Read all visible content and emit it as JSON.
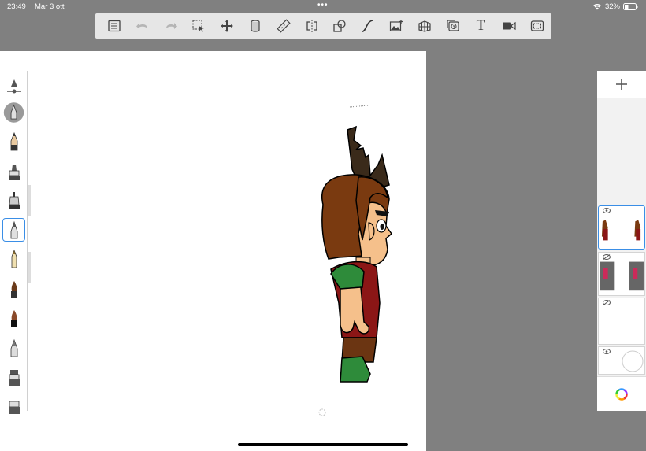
{
  "status": {
    "time": "23:49",
    "date": "Mar 3 ott",
    "battery": "32%"
  },
  "toolbar": {
    "tools": [
      {
        "name": "gallery-list-icon"
      },
      {
        "name": "undo-icon"
      },
      {
        "name": "redo-icon"
      },
      {
        "name": "selection-icon"
      },
      {
        "name": "transform-icon"
      },
      {
        "name": "fill-icon"
      },
      {
        "name": "ruler-icon"
      },
      {
        "name": "symmetry-icon"
      },
      {
        "name": "shapes-icon"
      },
      {
        "name": "curve-icon"
      },
      {
        "name": "import-image-icon"
      },
      {
        "name": "perspective-icon"
      },
      {
        "name": "timelapse-icon"
      },
      {
        "name": "text-icon",
        "label": "T"
      },
      {
        "name": "video-icon"
      },
      {
        "name": "fullscreen-icon"
      }
    ]
  },
  "brushes": [
    {
      "name": "brush-size-slider"
    },
    {
      "name": "brush-opacity"
    },
    {
      "name": "pencil-brush"
    },
    {
      "name": "marker-brush"
    },
    {
      "name": "airbrush-brush"
    },
    {
      "name": "hard-brush"
    },
    {
      "name": "ink-pen-brush"
    },
    {
      "name": "paint-brush"
    },
    {
      "name": "dark-brush"
    },
    {
      "name": "smudge-brush"
    },
    {
      "name": "eraser-brush"
    },
    {
      "name": "bucket-brush"
    }
  ],
  "layers": [
    {
      "name": "layer-1",
      "visible": true,
      "selected": true
    },
    {
      "name": "layer-2",
      "visible": false,
      "selected": false
    },
    {
      "name": "layer-3",
      "visible": false,
      "selected": false
    },
    {
      "name": "layer-background",
      "visible": true,
      "selected": false
    }
  ],
  "colors": {
    "accent": "#3a8ee6",
    "canvas_bg": "#808080",
    "hair": "#7a3a10",
    "skin": "#f5c08b",
    "vest": "#8b1616",
    "sleeve": "#2e8b3a",
    "pants": "#6b3512"
  }
}
